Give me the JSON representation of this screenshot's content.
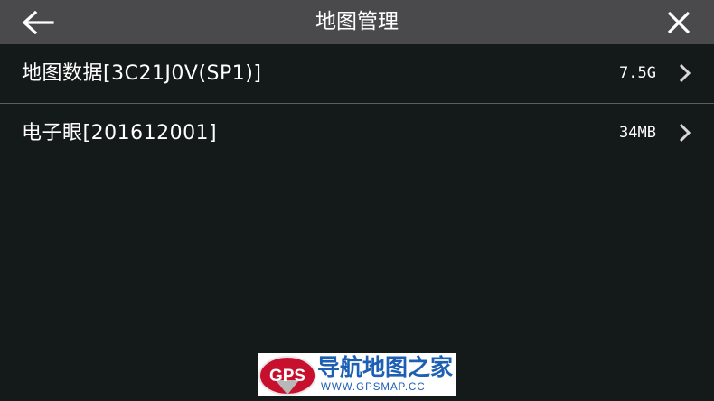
{
  "header": {
    "title": "地图管理",
    "back_icon": "arrow-left-icon",
    "close_icon": "close-icon"
  },
  "items": [
    {
      "label": "地图数据[3C21J0V(SP1)]",
      "size": "7.5G"
    },
    {
      "label": "电子眼[201612001]",
      "size": "34MB"
    }
  ],
  "watermark": {
    "logo_text": "GPS",
    "name": "导航地图之家",
    "url": "WWW.GPSMAP.CC"
  },
  "colors": {
    "header_bg": "#4a4a4c",
    "page_bg": "#141a19",
    "divider": "#5a5e5e",
    "watermark_blue": "#1d5fb3",
    "logo_red": "#c8102e"
  }
}
